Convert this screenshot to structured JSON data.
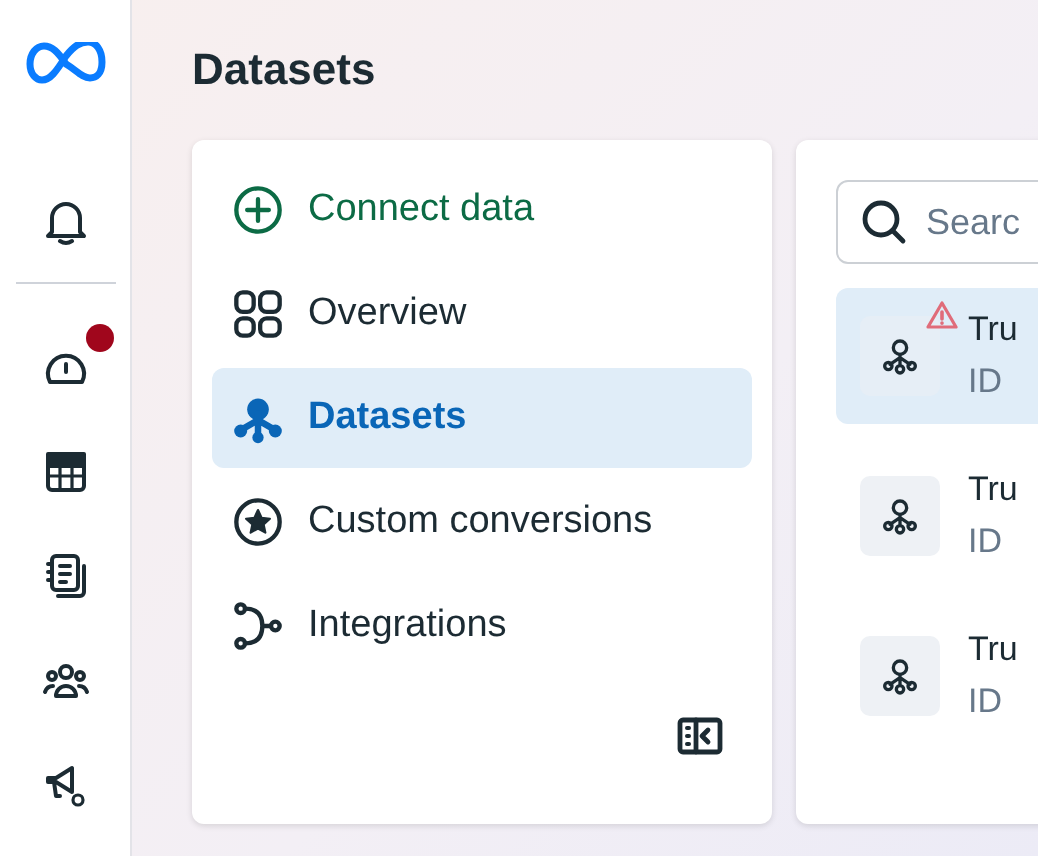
{
  "rail": {
    "items": [
      {
        "badge": false
      },
      {
        "badge": true
      },
      {
        "badge": false
      },
      {
        "badge": false
      },
      {
        "badge": false
      },
      {
        "badge": false
      }
    ]
  },
  "page": {
    "title": "Datasets"
  },
  "nav": {
    "items": [
      {
        "label": "Connect data",
        "kind": "action",
        "selected": false
      },
      {
        "label": "Overview",
        "kind": "link",
        "selected": false
      },
      {
        "label": "Datasets",
        "kind": "link",
        "selected": true
      },
      {
        "label": "Custom conversions",
        "kind": "link",
        "selected": false
      },
      {
        "label": "Integrations",
        "kind": "link",
        "selected": false
      }
    ]
  },
  "datasets": {
    "search": {
      "placeholder": "Searc"
    },
    "items": [
      {
        "title": "Tru",
        "subtitle": "ID",
        "selected": true,
        "warning": true
      },
      {
        "title": "Tru",
        "subtitle": "ID",
        "selected": false,
        "warning": false
      },
      {
        "title": "Tru",
        "subtitle": "ID",
        "selected": false,
        "warning": false
      }
    ]
  }
}
